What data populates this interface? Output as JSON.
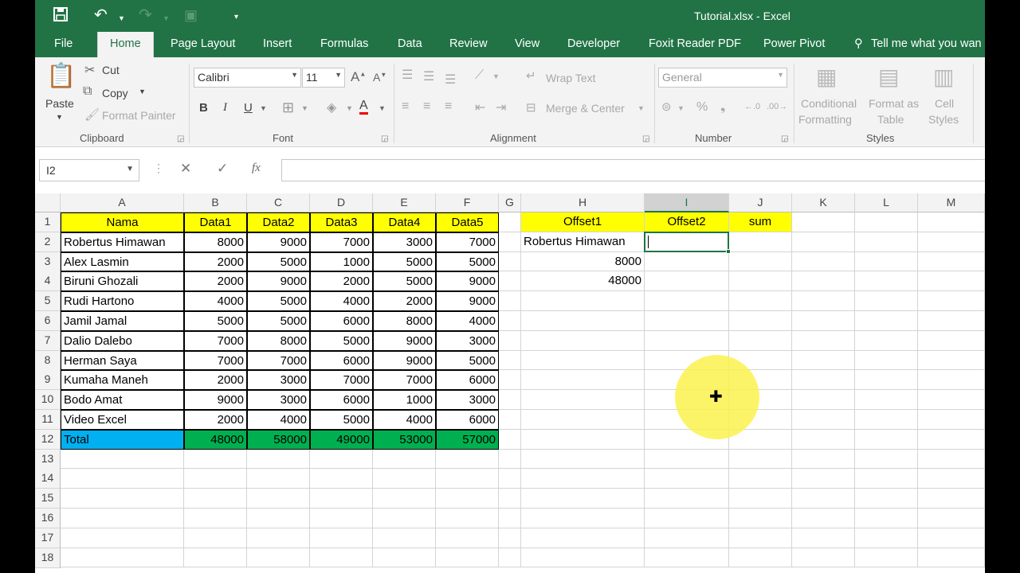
{
  "title_bar": {
    "title": "Tutorial.xlsx - Excel"
  },
  "tabs": [
    "File",
    "Home",
    "Page Layout",
    "Insert",
    "Formulas",
    "Data",
    "Review",
    "View",
    "Developer",
    "Foxit Reader PDF",
    "Power Pivot",
    "Tell me what you wan"
  ],
  "ribbon": {
    "clipboard": {
      "paste": "Paste",
      "cut": "Cut",
      "copy": "Copy",
      "format_painter": "Format Painter",
      "group": "Clipboard"
    },
    "font": {
      "name": "Calibri",
      "size": "11",
      "bold": "B",
      "italic": "I",
      "underline": "U",
      "group": "Font"
    },
    "alignment": {
      "wrap": "Wrap Text",
      "merge": "Merge & Center",
      "group": "Alignment"
    },
    "number": {
      "format": "General",
      "group": "Number"
    },
    "styles": {
      "cond1": "Conditional",
      "cond2": "Formatting",
      "fmt1": "Format as",
      "fmt2": "Table",
      "cell1": "Cell",
      "cell2": "Styles",
      "group": "Styles"
    }
  },
  "formula_bar": {
    "name_box": "I2",
    "formula": "",
    "fx": "fx"
  },
  "columns": [
    "A",
    "B",
    "C",
    "D",
    "E",
    "F",
    "G",
    "H",
    "I",
    "J",
    "K",
    "L",
    "M"
  ],
  "rows": [
    "1",
    "2",
    "3",
    "4",
    "5",
    "6",
    "7",
    "8",
    "9",
    "10",
    "11",
    "12",
    "13",
    "14",
    "15",
    "16",
    "17",
    "18"
  ],
  "table": {
    "headers": [
      "Nama",
      "Data1",
      "Data2",
      "Data3",
      "Data4",
      "Data5"
    ],
    "rows": [
      [
        "Robertus Himawan",
        "8000",
        "9000",
        "7000",
        "3000",
        "7000"
      ],
      [
        "Alex Lasmin",
        "2000",
        "5000",
        "1000",
        "5000",
        "5000"
      ],
      [
        "Biruni Ghozali",
        "2000",
        "9000",
        "2000",
        "5000",
        "9000"
      ],
      [
        "Rudi Hartono",
        "4000",
        "5000",
        "4000",
        "2000",
        "9000"
      ],
      [
        "Jamil Jamal",
        "5000",
        "5000",
        "6000",
        "8000",
        "4000"
      ],
      [
        "Dalio Dalebo",
        "7000",
        "8000",
        "5000",
        "9000",
        "3000"
      ],
      [
        "Herman Saya",
        "7000",
        "7000",
        "6000",
        "9000",
        "5000"
      ],
      [
        "Kumaha Maneh",
        "2000",
        "3000",
        "7000",
        "7000",
        "6000"
      ],
      [
        "Bodo Amat",
        "9000",
        "3000",
        "6000",
        "1000",
        "3000"
      ],
      [
        "Video Excel",
        "2000",
        "4000",
        "5000",
        "4000",
        "6000"
      ]
    ],
    "total": [
      "Total",
      "48000",
      "58000",
      "49000",
      "53000",
      "57000"
    ]
  },
  "side": {
    "headers": [
      "Offset1",
      "Offset2",
      "sum"
    ],
    "h_values": [
      "Robertus Himawan",
      "8000",
      "48000"
    ]
  },
  "colors": {
    "excel_green": "#217346",
    "header_yellow": "#ffff00",
    "total_blue": "#00b0f0",
    "total_green": "#00b050"
  }
}
